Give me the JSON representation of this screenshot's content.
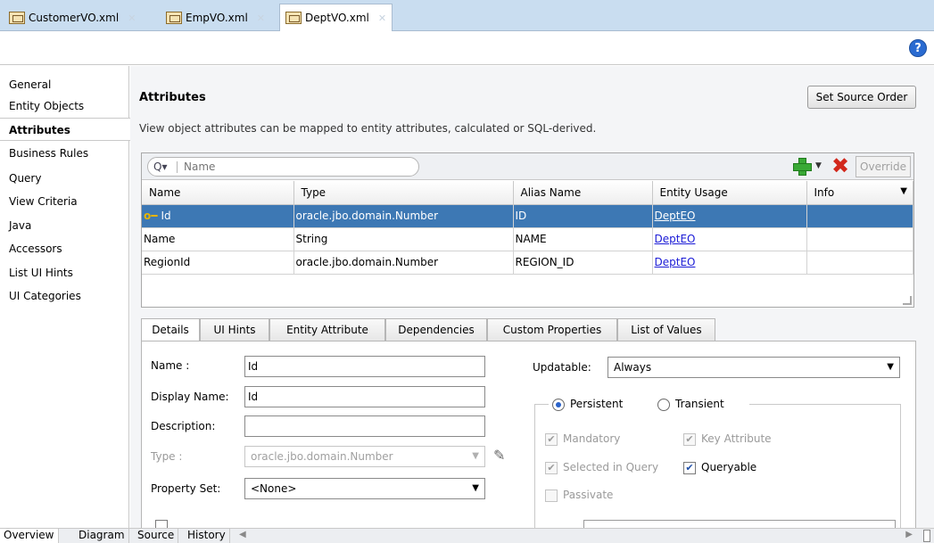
{
  "file_tabs": [
    {
      "label": "CustomerVO.xml",
      "active": false
    },
    {
      "label": "EmpVO.xml",
      "active": false
    },
    {
      "label": "DeptVO.xml",
      "active": true
    }
  ],
  "help_label": "?",
  "nav": {
    "items": [
      "General",
      "Entity Objects",
      "Attributes",
      "Business Rules",
      "Query",
      "View Criteria",
      "Java",
      "Accessors",
      "List UI Hints",
      "UI Categories"
    ],
    "active": "Attributes"
  },
  "section": {
    "title": "Attributes",
    "description": "View object attributes can be mapped to entity attributes, calculated or SQL-derived.",
    "set_source_order_label": "Set Source Order"
  },
  "search": {
    "placeholder": "Name"
  },
  "override_label": "Override",
  "grid": {
    "columns": [
      "Name",
      "Type",
      "Alias Name",
      "Entity Usage",
      "Info"
    ],
    "rows": [
      {
        "name": "Id",
        "type": "oracle.jbo.domain.Number",
        "alias": "ID",
        "entity_usage": "DeptEO",
        "info": "",
        "key": true,
        "selected": true
      },
      {
        "name": "Name",
        "type": "String",
        "alias": "NAME",
        "entity_usage": "DeptEO",
        "info": "",
        "key": false,
        "selected": false
      },
      {
        "name": "RegionId",
        "type": "oracle.jbo.domain.Number",
        "alias": "REGION_ID",
        "entity_usage": "DeptEO",
        "info": "",
        "key": false,
        "selected": false
      }
    ]
  },
  "detail_tabs": [
    "Details",
    "UI Hints",
    "Entity Attribute",
    "Dependencies",
    "Custom Properties",
    "List of Values"
  ],
  "details": {
    "name_label": "Name :",
    "name_value": "Id",
    "display_name_label": "Display Name:",
    "display_name_value": "Id",
    "description_label": "Description:",
    "description_value": "",
    "type_label": "Type :",
    "type_value": "oracle.jbo.domain.Number",
    "property_set_label": "Property Set:",
    "property_set_value": "<None>",
    "updatable_label": "Updatable:",
    "updatable_value": "Always",
    "persistent_label": "Persistent",
    "transient_label": "Transient",
    "mandatory_label": "Mandatory",
    "key_attribute_label": "Key Attribute",
    "selected_in_query_label": "Selected in Query",
    "queryable_label": "Queryable",
    "passivate_label": "Passivate"
  },
  "bottom_tabs": [
    "Overview",
    "Diagram",
    "Source",
    "History"
  ]
}
